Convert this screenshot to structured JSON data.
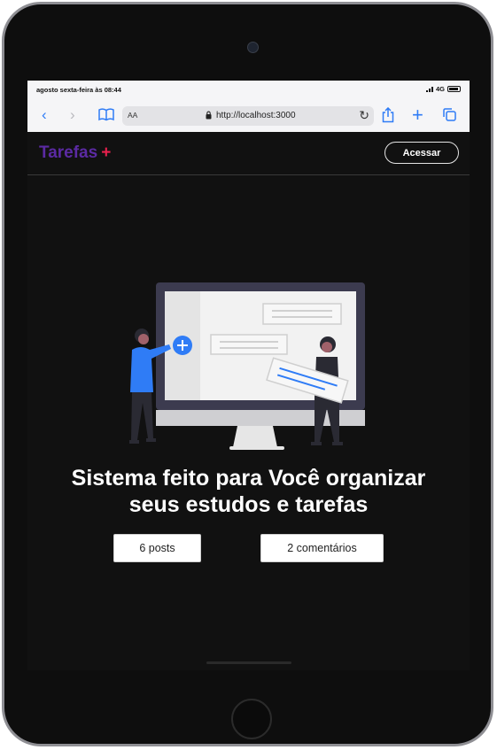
{
  "status_bar": {
    "time": "agosto sexta-feira às 08:44",
    "network": "4G"
  },
  "browser": {
    "url_prefix": "AA",
    "url": "http://localhost:3000"
  },
  "navbar": {
    "brand_name": "Tarefas",
    "brand_plus": "+",
    "login_label": "Acessar"
  },
  "hero": {
    "headline": "Sistema feito para Você organizar seus estudos e tarefas"
  },
  "stats": {
    "posts": "6 posts",
    "comments": "2 comentários"
  },
  "colors": {
    "brand": "#5b2aa3",
    "plus": "#e8204d",
    "accent": "#2f7cf6",
    "background": "#111111"
  }
}
